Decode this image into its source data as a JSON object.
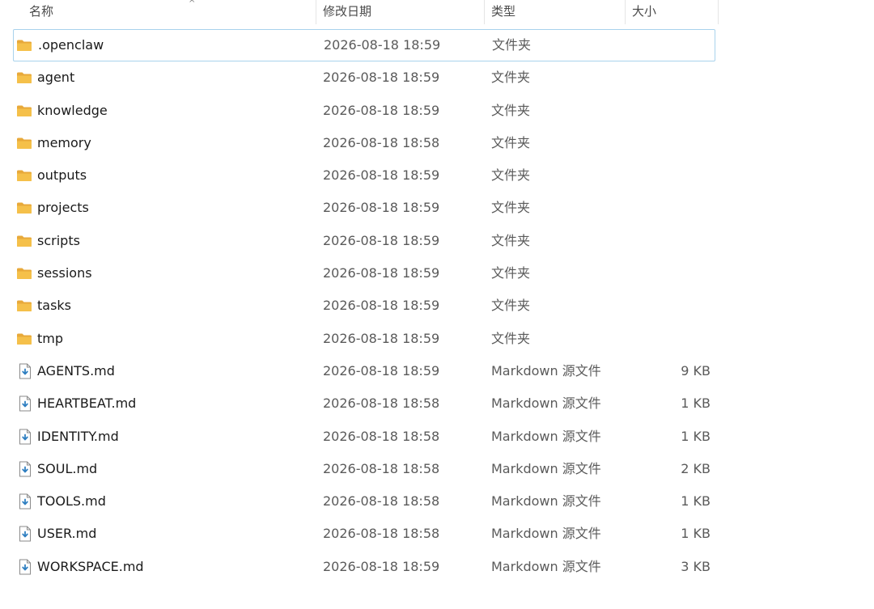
{
  "columns": {
    "name": "名称",
    "date": "修改日期",
    "type": "类型",
    "size": "大小"
  },
  "colors": {
    "folder": "#f5c04a",
    "folder_tab": "#e8a93a",
    "selected_border": "#a8d2ec",
    "md_icon": "#2f7fc1"
  },
  "items": [
    {
      "name": ".openclaw",
      "date": "2026-08-18 18:59",
      "type": "文件夹",
      "size": "",
      "icon": "folder-icon",
      "selected": true
    },
    {
      "name": "agent",
      "date": "2026-08-18 18:59",
      "type": "文件夹",
      "size": "",
      "icon": "folder-icon"
    },
    {
      "name": "knowledge",
      "date": "2026-08-18 18:59",
      "type": "文件夹",
      "size": "",
      "icon": "folder-icon"
    },
    {
      "name": "memory",
      "date": "2026-08-18 18:58",
      "type": "文件夹",
      "size": "",
      "icon": "folder-icon"
    },
    {
      "name": "outputs",
      "date": "2026-08-18 18:59",
      "type": "文件夹",
      "size": "",
      "icon": "folder-icon"
    },
    {
      "name": "projects",
      "date": "2026-08-18 18:59",
      "type": "文件夹",
      "size": "",
      "icon": "folder-icon"
    },
    {
      "name": "scripts",
      "date": "2026-08-18 18:59",
      "type": "文件夹",
      "size": "",
      "icon": "folder-icon"
    },
    {
      "name": "sessions",
      "date": "2026-08-18 18:59",
      "type": "文件夹",
      "size": "",
      "icon": "folder-icon"
    },
    {
      "name": "tasks",
      "date": "2026-08-18 18:59",
      "type": "文件夹",
      "size": "",
      "icon": "folder-icon"
    },
    {
      "name": "tmp",
      "date": "2026-08-18 18:59",
      "type": "文件夹",
      "size": "",
      "icon": "folder-icon"
    },
    {
      "name": "AGENTS.md",
      "date": "2026-08-18 18:59",
      "type": "Markdown 源文件",
      "size": "9 KB",
      "icon": "md-file-icon"
    },
    {
      "name": "HEARTBEAT.md",
      "date": "2026-08-18 18:58",
      "type": "Markdown 源文件",
      "size": "1 KB",
      "icon": "md-file-icon"
    },
    {
      "name": "IDENTITY.md",
      "date": "2026-08-18 18:58",
      "type": "Markdown 源文件",
      "size": "1 KB",
      "icon": "md-file-icon"
    },
    {
      "name": "SOUL.md",
      "date": "2026-08-18 18:58",
      "type": "Markdown 源文件",
      "size": "2 KB",
      "icon": "md-file-icon"
    },
    {
      "name": "TOOLS.md",
      "date": "2026-08-18 18:58",
      "type": "Markdown 源文件",
      "size": "1 KB",
      "icon": "md-file-icon"
    },
    {
      "name": "USER.md",
      "date": "2026-08-18 18:58",
      "type": "Markdown 源文件",
      "size": "1 KB",
      "icon": "md-file-icon"
    },
    {
      "name": "WORKSPACE.md",
      "date": "2026-08-18 18:59",
      "type": "Markdown 源文件",
      "size": "3 KB",
      "icon": "md-file-icon"
    }
  ]
}
